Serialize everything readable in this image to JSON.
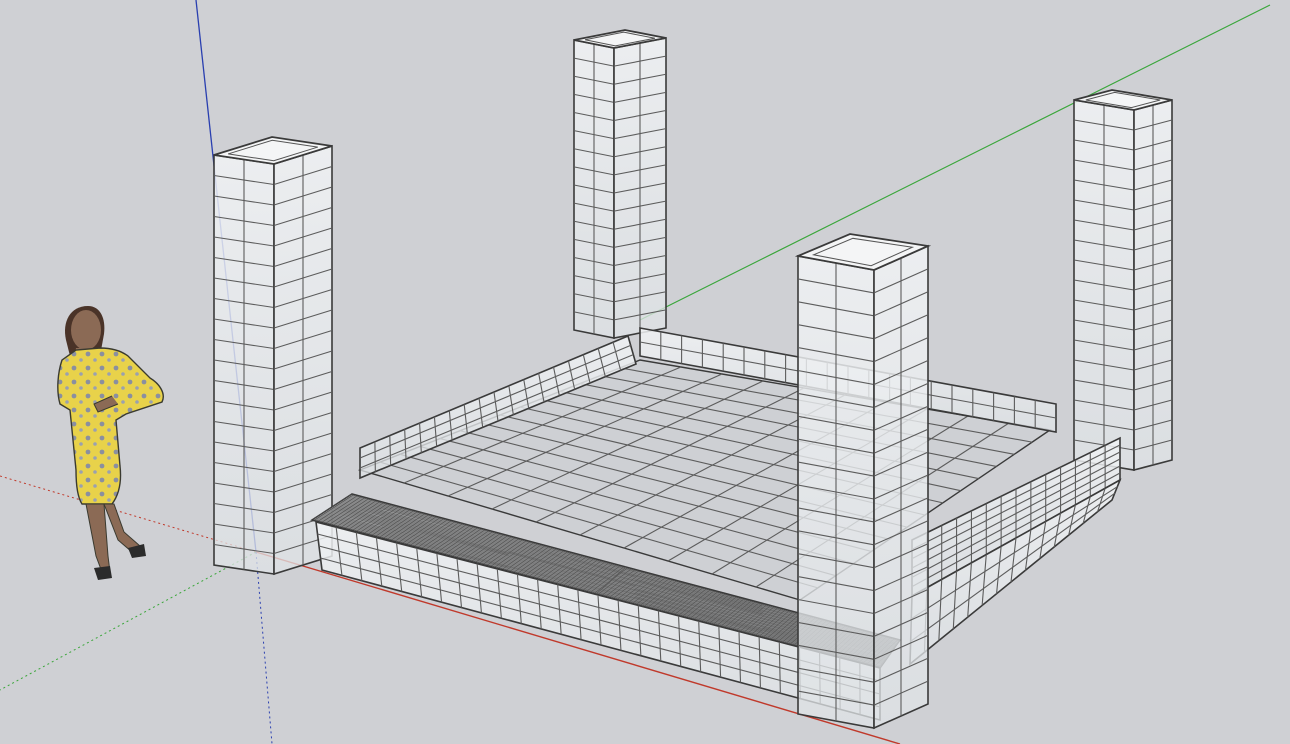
{
  "viewport": {
    "background": "#cfd0d4",
    "axis_colors": {
      "red": "#c0392b",
      "green": "#3aa63a",
      "blue": "#2a3fb0"
    },
    "frame_color": "#3a3a3a",
    "glass_color": "#e9ecef"
  },
  "scene": {
    "figure_icon": "person-scale-figure-icon",
    "model": "frame-structure"
  }
}
